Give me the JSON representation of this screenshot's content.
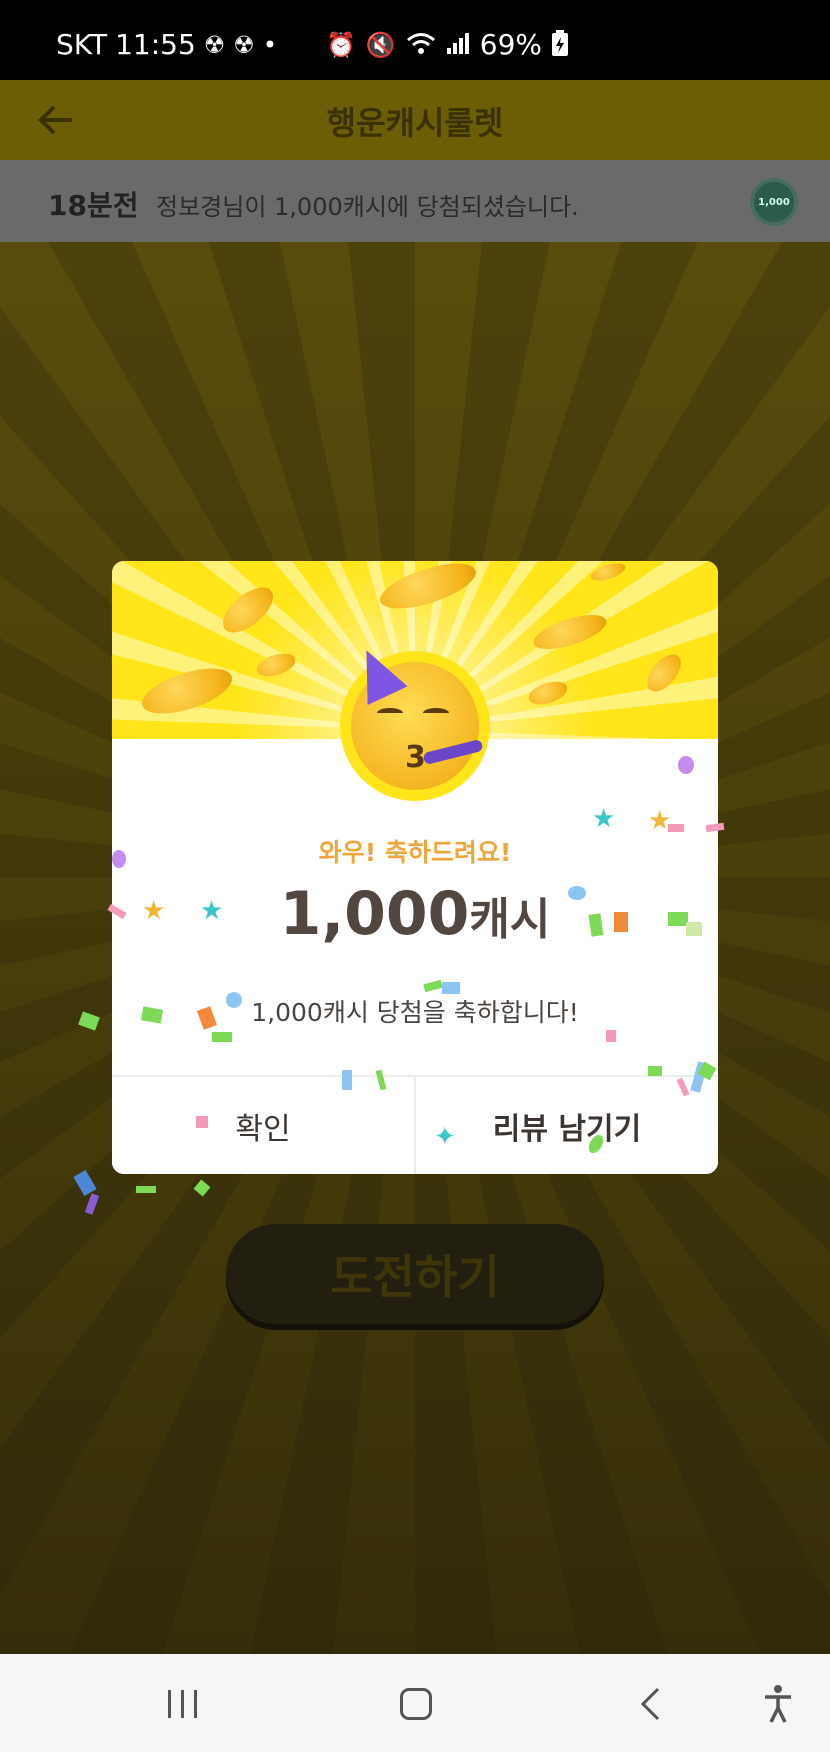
{
  "status_bar": {
    "carrier": "SKT",
    "time": "11:55",
    "battery": "69%",
    "icons": [
      "nuclear-icon",
      "nuclear-icon",
      "dot-icon",
      "alarm-icon",
      "mute-icon",
      "wifi-icon",
      "signal-icon",
      "battery-charging-icon"
    ]
  },
  "header": {
    "title": "행운캐시룰렛",
    "back_icon": "arrow-left-icon"
  },
  "ticker": {
    "time_ago": "18분전",
    "message": "정보경님이 1,000캐시에 당첨되셨습니다.",
    "coin_label": "1,000"
  },
  "challenge_button": {
    "label": "도전하기"
  },
  "modal": {
    "headline": "와우! 축하드려요!",
    "amount_number": "1,000",
    "amount_unit": "캐시",
    "description": "1,000캐시 당첨을 축하합니다!",
    "confirm_label": "확인",
    "review_label": "리뷰 남기기",
    "emoji": "partying-face-icon",
    "colors": {
      "banner": "#ffe51a",
      "headline": "#f0a53a",
      "text": "#524640"
    }
  },
  "nav_bar": {
    "icons": [
      "recents-icon",
      "home-icon",
      "back-icon",
      "accessibility-icon"
    ]
  }
}
